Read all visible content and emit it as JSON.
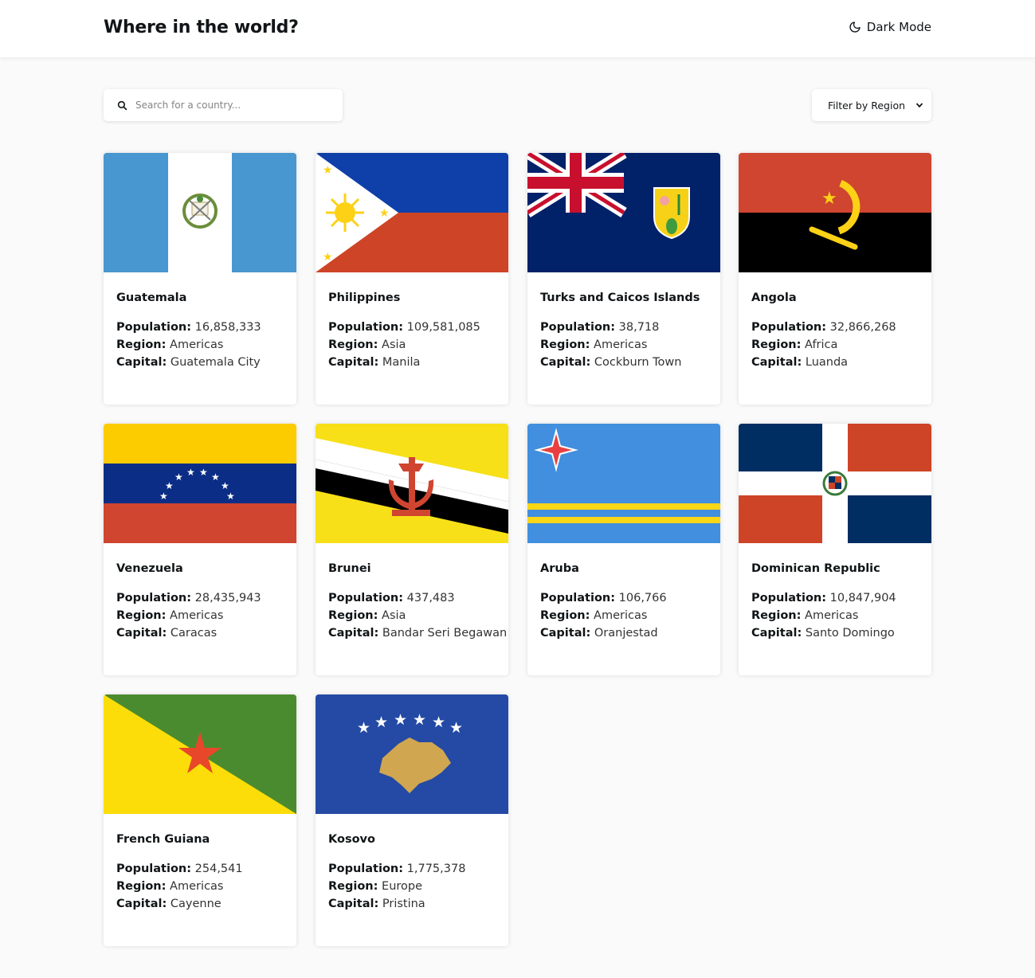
{
  "header": {
    "title": "Where in the world?",
    "mode_label": "Dark Mode"
  },
  "search": {
    "placeholder": "Search for a country..."
  },
  "filter": {
    "label": "Filter by Region"
  },
  "labels": {
    "population": "Population:",
    "region": "Region:",
    "capital": "Capital:"
  },
  "countries": [
    {
      "name": "Guatemala",
      "population": "16,858,333",
      "region": "Americas",
      "capital": "Guatemala City"
    },
    {
      "name": "Philippines",
      "population": "109,581,085",
      "region": "Asia",
      "capital": "Manila"
    },
    {
      "name": "Turks and Caicos Islands",
      "population": "38,718",
      "region": "Americas",
      "capital": "Cockburn Town"
    },
    {
      "name": "Angola",
      "population": "32,866,268",
      "region": "Africa",
      "capital": "Luanda"
    },
    {
      "name": "Venezuela",
      "population": "28,435,943",
      "region": "Americas",
      "capital": "Caracas"
    },
    {
      "name": "Brunei",
      "population": "437,483",
      "region": "Asia",
      "capital": "Bandar Seri Begawan"
    },
    {
      "name": "Aruba",
      "population": "106,766",
      "region": "Americas",
      "capital": "Oranjestad"
    },
    {
      "name": "Dominican Republic",
      "population": "10,847,904",
      "region": "Americas",
      "capital": "Santo Domingo"
    },
    {
      "name": "French Guiana",
      "population": "254,541",
      "region": "Americas",
      "capital": "Cayenne"
    },
    {
      "name": "Kosovo",
      "population": "1,775,378",
      "region": "Europe",
      "capital": "Pristina"
    }
  ]
}
